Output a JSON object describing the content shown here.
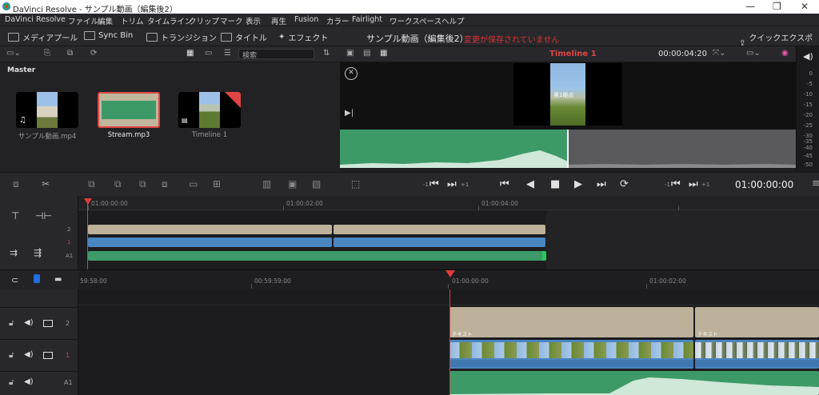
{
  "window": {
    "title": "DaVinci Resolve - サンプル動画（編集後2）",
    "minimize": "—",
    "maximize": "❐",
    "close": "✕"
  },
  "menu": [
    "DaVinci Resolve",
    "ファイル",
    "編集",
    "トリム",
    "タイムライン",
    "クリップ",
    "マーク",
    "表示",
    "再生",
    "Fusion",
    "カラー",
    "Fairlight",
    "ワークスペース",
    "ヘルプ"
  ],
  "toolbar": {
    "media_pool": "メディアプール",
    "sync_bin": "Sync Bin",
    "transitions": "トランジション",
    "titles": "タイトル",
    "effects": "エフェクト",
    "project_name": "サンプル動画（編集後2）",
    "unsaved": "変更が保存されていません",
    "quick_export": "クイックエクスポート"
  },
  "media_pool": {
    "search_placeholder": "検索",
    "bin": "Master",
    "clips": [
      {
        "name": "サンプル動画.mp4"
      },
      {
        "name": "Stream.mp3"
      },
      {
        "name": "Timeline 1"
      }
    ]
  },
  "viewer": {
    "timeline_name": "Timeline 1",
    "duration": "00:00:04:20",
    "video_caption": "第1拠点",
    "timecode": "01:00:00:00",
    "jog_left": "-1",
    "jog_right": "+1"
  },
  "meter_scale": [
    "0",
    "-5",
    "-10",
    "-15",
    "-20",
    "-25",
    "-30",
    "-35",
    "-40",
    "-45",
    "-50"
  ],
  "upper_timeline": {
    "ruler": [
      "01:00:00:00",
      "01:00:02:00",
      "01:00:04:00"
    ],
    "tracks": [
      "2",
      "1",
      "A1"
    ]
  },
  "lower_timeline": {
    "ruler": [
      "59:58:00",
      "00:59:59:00",
      "01:00:00:00",
      "01:00:02:00"
    ],
    "tracks": [
      "2",
      "1",
      "A1"
    ],
    "text_label": "テキスト"
  },
  "colors": {
    "accent_red": "#e03b3b",
    "audio_green": "#3d9a68",
    "video_blue": "#4a86c0",
    "title_beige": "#bdb19a"
  }
}
